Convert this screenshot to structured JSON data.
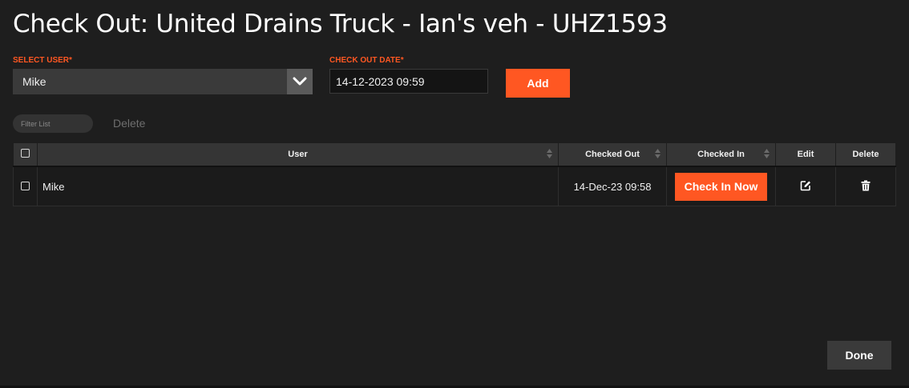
{
  "dialog": {
    "title": "Check Out: United Drains Truck - Ian's veh - UHZ1593"
  },
  "form": {
    "user_label": "SELECT USER*",
    "user_value": "Mike",
    "date_label": "CHECK OUT DATE*",
    "date_value": "14-12-2023 09:59",
    "add_label": "Add"
  },
  "toolbar": {
    "filter_placeholder": "Filter List",
    "delete_label": "Delete"
  },
  "table": {
    "columns": {
      "user": "User",
      "checked_out": "Checked Out",
      "checked_in": "Checked In",
      "edit": "Edit",
      "delete": "Delete"
    },
    "rows": [
      {
        "user": "Mike",
        "checked_out": "14-Dec-23 09:58",
        "check_in_label": "Check In Now"
      }
    ]
  },
  "footer": {
    "done_label": "Done"
  },
  "colors": {
    "accent": "#ff5722",
    "background": "#1e1e1e",
    "header": "#353535"
  },
  "icons": {
    "dropdown": "chevron-down-icon",
    "sort": "sort-icon",
    "edit": "edit-icon",
    "delete": "trash-icon"
  }
}
